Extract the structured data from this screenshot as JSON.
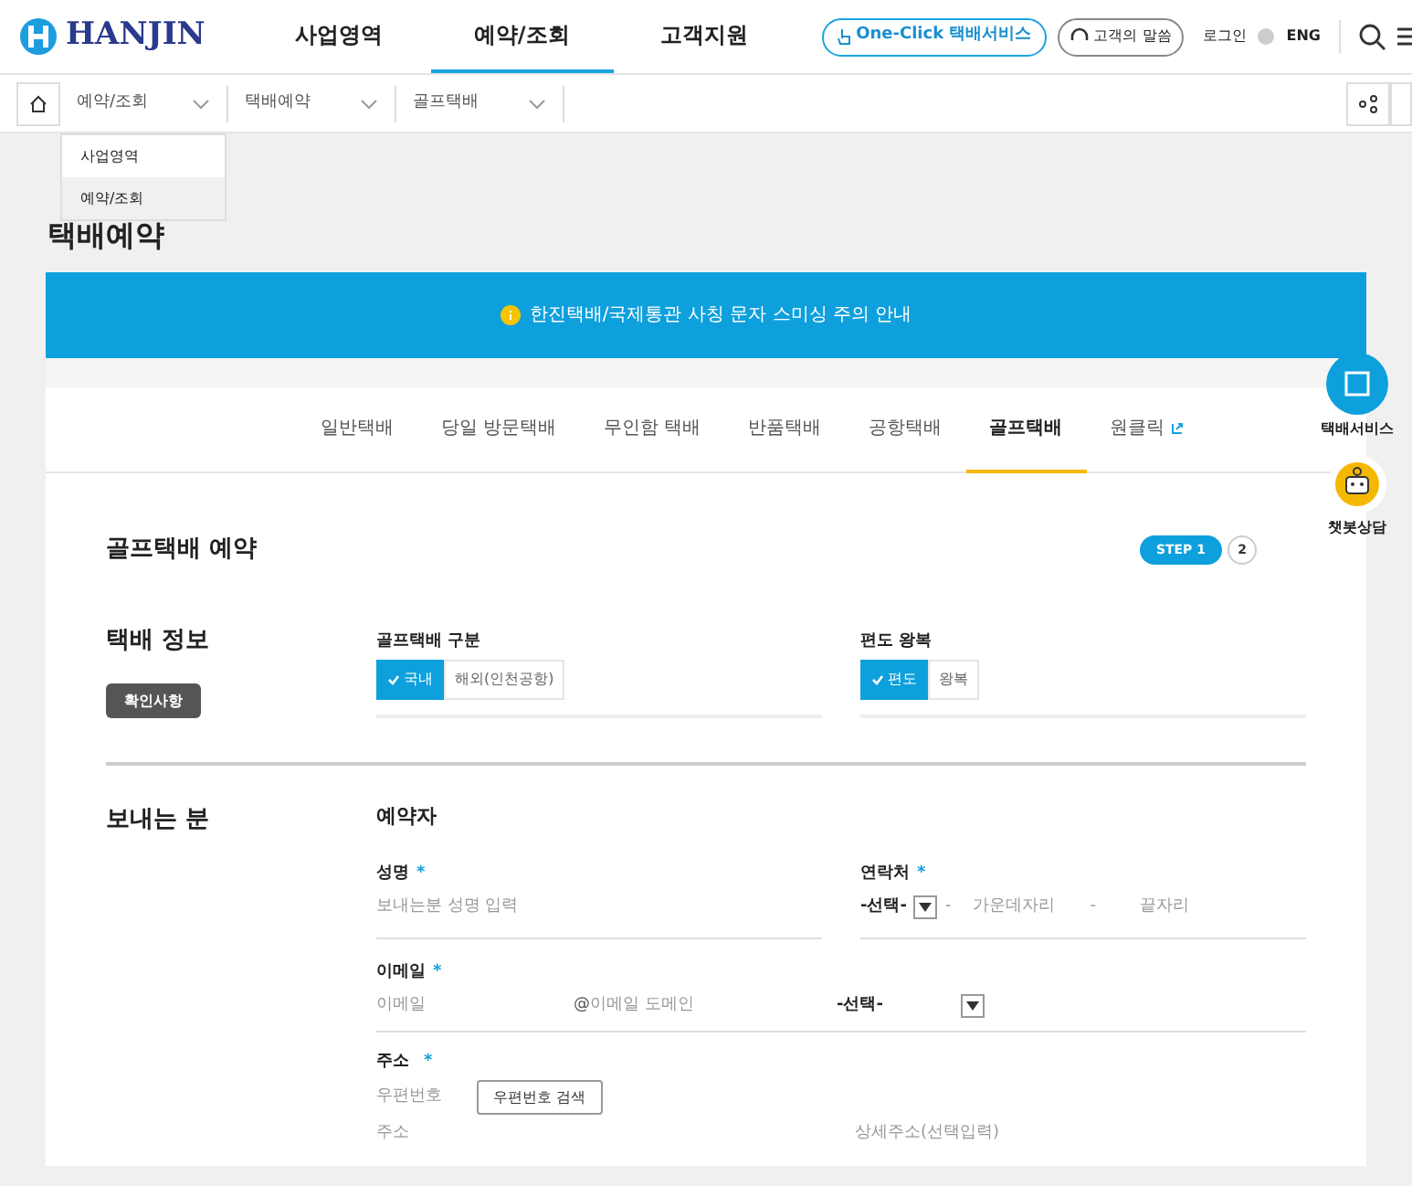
{
  "header": {
    "logo": "HANJIN",
    "nav": [
      {
        "label": "사업영역",
        "selected": false
      },
      {
        "label": "예약/조회",
        "selected": true
      },
      {
        "label": "고객지원",
        "selected": false
      }
    ],
    "one_click": "One-Click 택배서비스",
    "voice": "고객의 말씀",
    "login": "로그인",
    "lang": "ENG"
  },
  "breadcrumb": [
    {
      "label": "예약/조회"
    },
    {
      "label": "택배예약"
    },
    {
      "label": "골프택배"
    }
  ],
  "breadcrumb_menu": [
    {
      "label": "사업영역",
      "selected": false
    },
    {
      "label": "예약/조회",
      "selected": true
    }
  ],
  "page_title": "택배예약",
  "notice": "한진택배/국제통관 사칭 문자 스미싱 주의 안내",
  "tabs": [
    {
      "label": "일반택배",
      "selected": false,
      "external": false
    },
    {
      "label": "당일 방문택배",
      "selected": false,
      "external": false
    },
    {
      "label": "무인함 택배",
      "selected": false,
      "external": false
    },
    {
      "label": "반품택배",
      "selected": false,
      "external": false
    },
    {
      "label": "공항택배",
      "selected": false,
      "external": false
    },
    {
      "label": "골프택배",
      "selected": true,
      "external": false
    },
    {
      "label": "원클릭",
      "selected": false,
      "external": true
    }
  ],
  "form_title": "골프택배 예약",
  "steps": [
    {
      "label": "STEP 1",
      "selected": true
    },
    {
      "label": "2",
      "selected": false
    }
  ],
  "floating": [
    {
      "kind": "box",
      "label": "택배서비스"
    },
    {
      "kind": "bot",
      "label": "챗봇상담"
    }
  ],
  "info": {
    "title": "택배 정보",
    "confirm_button": "확인사항",
    "groups": [
      {
        "label": "골프택배 구분",
        "options": [
          {
            "label": "국내",
            "selected": true
          },
          {
            "label": "해외(인천공항)",
            "selected": false
          }
        ]
      },
      {
        "label": "편도 왕복",
        "options": [
          {
            "label": "편도",
            "selected": true
          },
          {
            "label": "왕복",
            "selected": false
          }
        ]
      }
    ]
  },
  "sender": {
    "title": "보내는 분",
    "subtitle": "예약자",
    "name": {
      "label": "성명",
      "required": "*",
      "placeholder": "보내는분 성명 입력"
    },
    "phone": {
      "label": "연락처",
      "required": "*",
      "select": "-선택-",
      "sep": "-",
      "middle": {
        "placeholder": "가운데자리"
      },
      "sep2": "-",
      "last": {
        "placeholder": "끝자리"
      }
    },
    "email": {
      "label": "이메일",
      "required": "*",
      "placeholder": "이메일",
      "at": "@",
      "domain": {
        "placeholder": "이메일 도메인"
      },
      "select": "-선택-"
    },
    "address": {
      "label": "주소",
      "required": "*",
      "zip": "우편번호",
      "zip_button": "우편번호 검색",
      "addr": "주소",
      "detail": "상세주소(선택입력)"
    }
  }
}
